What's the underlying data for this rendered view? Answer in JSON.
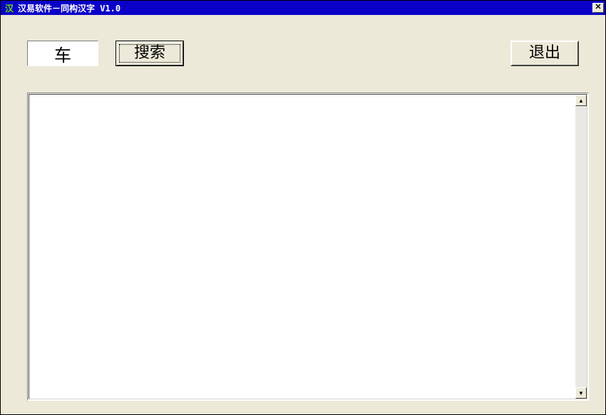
{
  "window": {
    "title": "汉易软件－同构汉字 V1.0",
    "icon_glyph": "汉"
  },
  "toolbar": {
    "search_input_value": "车",
    "search_button_label": "搜索",
    "exit_button_label": "退出"
  },
  "results": {
    "content": ""
  },
  "scroll": {
    "up_glyph": "▲",
    "down_glyph": "▼"
  },
  "close": {
    "glyph": "✕"
  }
}
